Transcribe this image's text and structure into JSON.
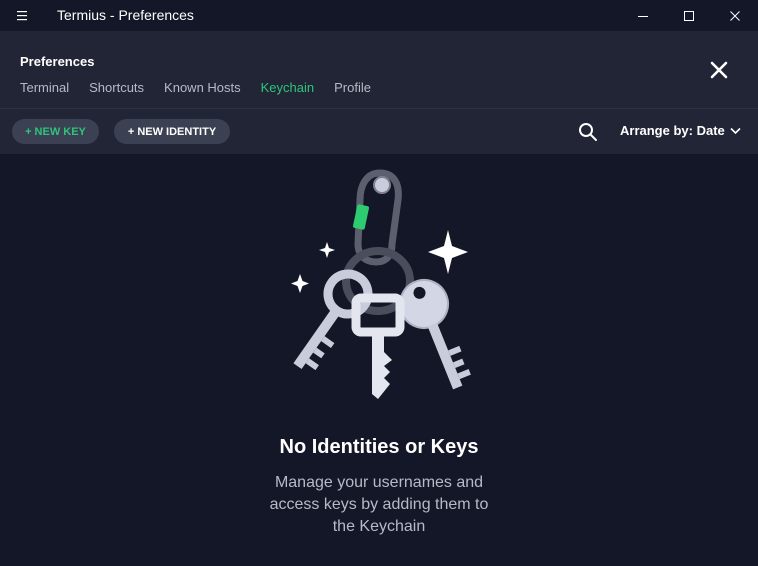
{
  "window": {
    "title": "Termius - Preferences"
  },
  "header": {
    "title": "Preferences",
    "tabs": [
      {
        "label": "Terminal"
      },
      {
        "label": "Shortcuts"
      },
      {
        "label": "Known Hosts"
      },
      {
        "label": "Keychain",
        "active": true
      },
      {
        "label": "Profile"
      }
    ]
  },
  "toolbar": {
    "new_key_label": "+ NEW KEY",
    "new_identity_label": "+ NEW IDENTITY",
    "arrange_label": "Arrange by: Date"
  },
  "empty_state": {
    "title": "No Identities or Keys",
    "description": "Manage your usernames and access keys by adding them to the Keychain"
  },
  "colors": {
    "accent": "#2ec47a",
    "background": "#141727",
    "panel": "#222536",
    "pill": "#3c4053"
  },
  "icons": {
    "menu": "hamburger-icon",
    "minimize": "minimize-icon",
    "maximize": "maximize-icon",
    "close": "close-icon",
    "search": "search-icon",
    "chevron": "chevron-down-icon"
  }
}
